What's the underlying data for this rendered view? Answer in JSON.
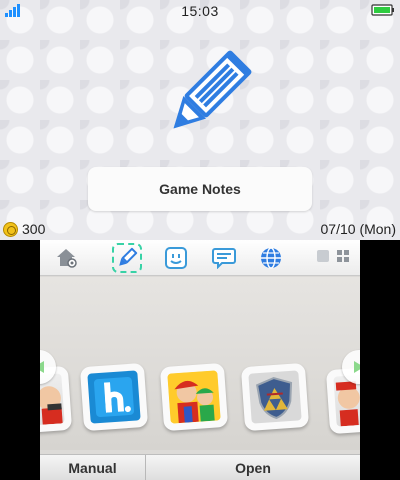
{
  "status_bar": {
    "time": "15:03",
    "wifi_icon": "wifi-signal-icon",
    "battery_icon": "battery-full-icon",
    "battery_color": "#2ecc40"
  },
  "top_screen": {
    "app_icon": "pencil-icon",
    "accent_color": "#2f7de1",
    "title": "Game Notes",
    "coins": "300",
    "date": "07/10 (Mon)"
  },
  "toolbar": {
    "items": [
      {
        "icon": "settings-house-icon"
      },
      {
        "icon": "pencil-icon",
        "selected": true
      },
      {
        "icon": "miiverse-face-icon"
      },
      {
        "icon": "speech-bubble-icon"
      },
      {
        "icon": "globe-icon"
      }
    ],
    "view_toggle": [
      "single-view-icon",
      "grid-view-icon"
    ]
  },
  "shelf": {
    "arrows": [
      "arrow-left-icon",
      "arrow-right-icon"
    ],
    "icons": [
      "mario-app-icon-partial",
      "h-blue-app-icon",
      "mario-luigi-app-icon",
      "zelda-shield-app-icon",
      "mario-app-icon-partial-right"
    ]
  },
  "bottom_bar": {
    "manual_label": "Manual",
    "open_label": "Open"
  }
}
